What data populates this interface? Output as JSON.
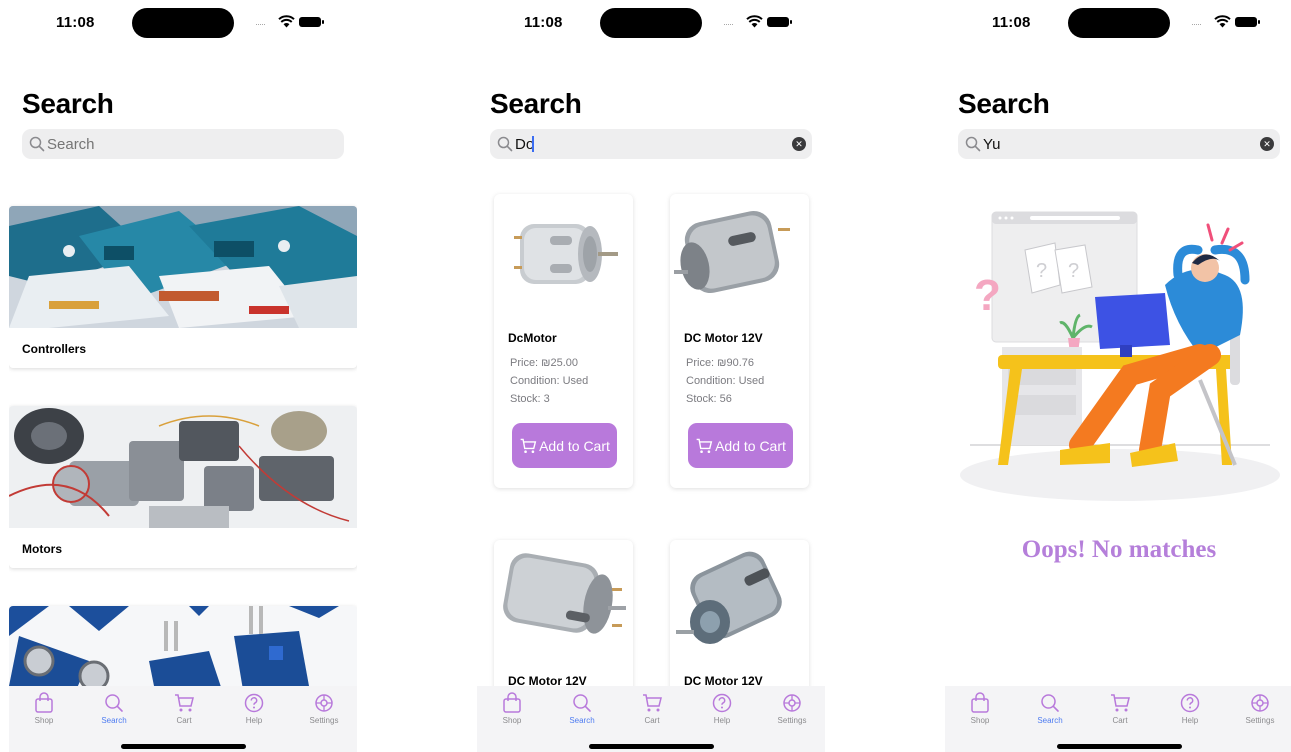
{
  "screens": [
    {
      "status": {
        "time": "11:08"
      },
      "title": "Search",
      "search": {
        "placeholder": "Search",
        "value": ""
      },
      "categories": [
        {
          "label": "Controllers"
        },
        {
          "label": "Motors"
        },
        {
          "label": ""
        }
      ]
    },
    {
      "status": {
        "time": "11:08"
      },
      "title": "Search",
      "search": {
        "value": "Do"
      },
      "products": [
        {
          "name": "DcMotor",
          "price": "Price: ₪25.00",
          "condition": "Condition: Used",
          "stock": "Stock: 3",
          "button": "Add to Cart"
        },
        {
          "name": "DC Motor 12V",
          "price": "Price: ₪90.76",
          "condition": "Condition: Used",
          "stock": "Stock: 56",
          "button": "Add to Cart"
        },
        {
          "name": "DC Motor 12V"
        },
        {
          "name": "DC Motor 12V"
        }
      ]
    },
    {
      "status": {
        "time": "11:08"
      },
      "title": "Search",
      "search": {
        "value": "Yu"
      },
      "empty_message": "Oops! No matches"
    }
  ],
  "tabbar": {
    "items": [
      {
        "label": "Shop",
        "icon": "shopping-bag-icon"
      },
      {
        "label": "Search",
        "icon": "search-icon"
      },
      {
        "label": "Cart",
        "icon": "cart-icon"
      },
      {
        "label": "Help",
        "icon": "help-icon"
      },
      {
        "label": "Settings",
        "icon": "settings-icon"
      }
    ],
    "active": "Search"
  },
  "colors": {
    "accent_purple": "#b879db",
    "tab_active_blue": "#4e7cf1",
    "search_bg": "#eeeeef",
    "oops_text": "#b57fda"
  }
}
